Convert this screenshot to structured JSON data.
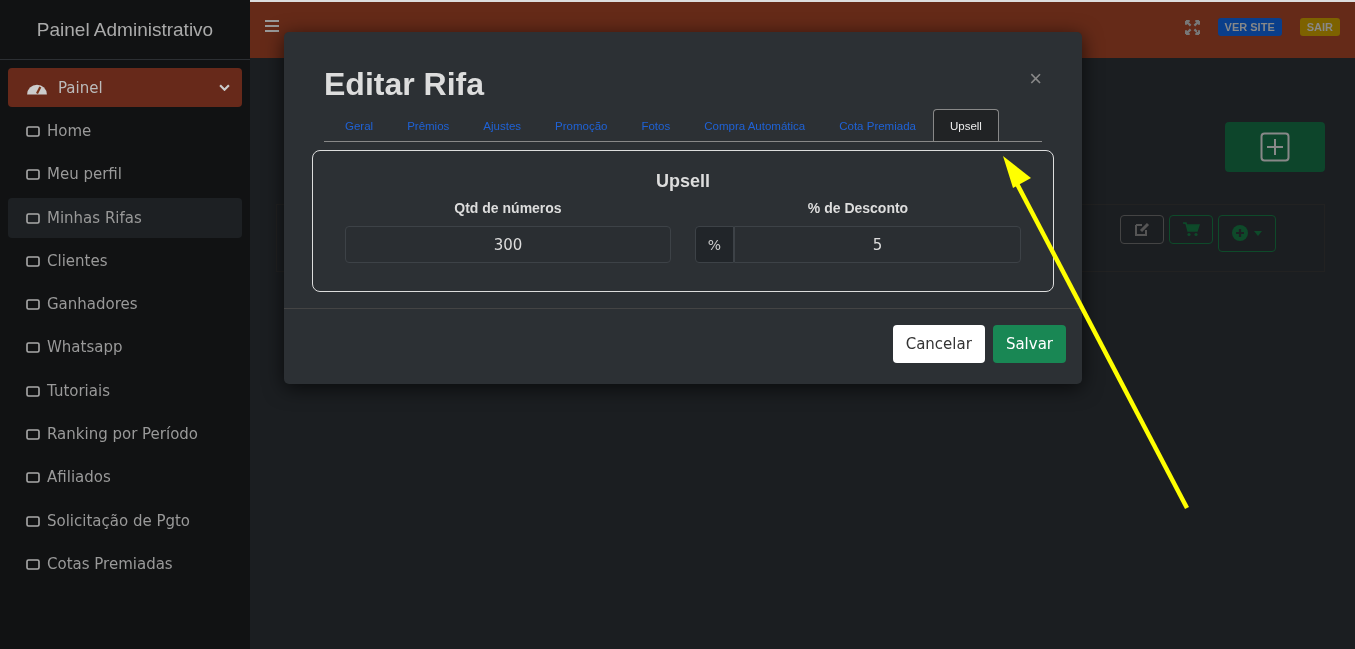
{
  "sidebar": {
    "title": "Painel Administrativo",
    "menu": {
      "label": "Painel",
      "expanded": true
    },
    "items": [
      {
        "label": "Home",
        "selected": false
      },
      {
        "label": "Meu perfil",
        "selected": false
      },
      {
        "label": "Minhas Rifas",
        "selected": true
      },
      {
        "label": "Clientes",
        "selected": false
      },
      {
        "label": "Ganhadores",
        "selected": false
      },
      {
        "label": "Whatsapp",
        "selected": false
      },
      {
        "label": "Tutoriais",
        "selected": false
      },
      {
        "label": "Ranking por Período",
        "selected": false
      },
      {
        "label": "Afiliados",
        "selected": false
      },
      {
        "label": "Solicitação de Pgto",
        "selected": false
      },
      {
        "label": "Cotas Premiadas",
        "selected": false
      }
    ]
  },
  "topbar": {
    "buttons": [
      {
        "label": "VER SITE",
        "kind": "primary"
      },
      {
        "label": "SAIR",
        "kind": "warning"
      }
    ]
  },
  "modal": {
    "title": "Editar Rifa",
    "close": "×",
    "tabs": [
      {
        "label": "Geral",
        "selected": false
      },
      {
        "label": "Prêmios",
        "selected": false
      },
      {
        "label": "Ajustes",
        "selected": false
      },
      {
        "label": "Promoção",
        "selected": false
      },
      {
        "label": "Fotos",
        "selected": false
      },
      {
        "label": "Compra Automática",
        "selected": false
      },
      {
        "label": "Cota Premiada",
        "selected": false
      },
      {
        "label": "Upsell",
        "selected": true
      }
    ],
    "section": "Upsell",
    "fields": [
      {
        "label": "Qtd de números",
        "value": "300"
      },
      {
        "label": "% de Desconto",
        "prefix": "%",
        "value": "5"
      }
    ],
    "buttons": [
      {
        "label": "Cancelar",
        "kind": "secondary"
      },
      {
        "label": "Salvar",
        "kind": "success"
      }
    ]
  }
}
